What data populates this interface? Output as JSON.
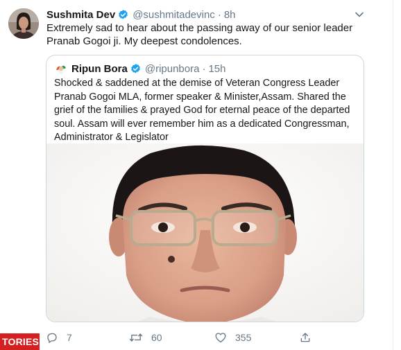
{
  "tweet": {
    "author_name": "Sushmita Dev",
    "author_handle": "@sushmitadevinc",
    "separator": "·",
    "time": "8h",
    "text": "Extremely sad to hear about the passing away of our senior leader Pranab Gogoi ji. My deepest condolences.",
    "verified": true
  },
  "quoted_tweet": {
    "author_name": "Ripun Bora",
    "author_handle": "@ripunbora",
    "separator": "·",
    "time": "15h",
    "text": "Shocked & saddened at the demise of Veteran Congress Leader Pranab Gogoi MLA, former speaker & Minister,Assam. Shared the grief of the families & prayed God for eternal peace of the departed soul. Assam will ever remember him as a dedicated Congressman, Administrator & Legislator",
    "verified": true,
    "media": "portrait-photo"
  },
  "actions": {
    "replies": "7",
    "retweets": "60",
    "likes": "355",
    "icons": [
      "reply-icon",
      "retweet-icon",
      "like-icon",
      "share-icon"
    ]
  },
  "badge": {
    "label": "TORIES"
  },
  "colors": {
    "verified_blue": "#1da1f2",
    "secondary_text": "#657786",
    "border": "#ccd6dd",
    "badge_red": "#d42020"
  }
}
